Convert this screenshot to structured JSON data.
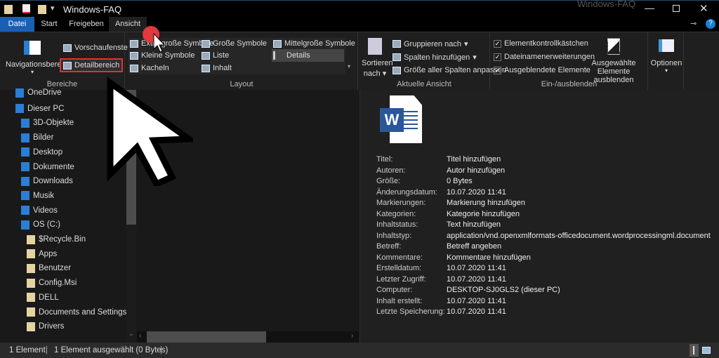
{
  "window": {
    "title": "Windows-FAQ",
    "watermark": "Windows-FAQ",
    "controls": [
      "minimize",
      "maximize",
      "close"
    ]
  },
  "tabs": [
    {
      "label": "Datei",
      "active_color": "#1a5fb4"
    },
    {
      "label": "Start"
    },
    {
      "label": "Freigeben"
    },
    {
      "label": "Ansicht",
      "selected": true
    }
  ],
  "ribbon": {
    "bereiche": {
      "label": "Bereiche",
      "navigationsbereich": "Navigationsbereich",
      "vorschaufenster": "Vorschaufenster",
      "detailbereich": "Detailbereich"
    },
    "layout": {
      "label": "Layout",
      "items": [
        "Extra große Symbole",
        "Große Symbole",
        "Mittelgroße Symbole",
        "Kleine Symbole",
        "Liste",
        "Details",
        "Kacheln",
        "Inhalt"
      ],
      "selected": "Details"
    },
    "aktuelle_ansicht": {
      "label": "Aktuelle Ansicht",
      "sortieren": "Sortieren",
      "nach": "nach",
      "gruppieren": "Gruppieren nach",
      "spalten": "Spalten hinzufügen",
      "groesse": "Größe aller Spalten anpassen"
    },
    "einaus": {
      "label": "Ein-/ausblenden",
      "checks": [
        {
          "label": "Elementkontrollkästchen",
          "checked": true
        },
        {
          "label": "Dateinamenerweiterungen",
          "checked": true
        },
        {
          "label": "Ausgeblendete Elemente",
          "checked": true
        }
      ],
      "hide1": "Ausgewählte",
      "hide2": "Elemente ausblenden"
    },
    "optionen": "Optionen"
  },
  "nav": [
    {
      "label": "OneDrive",
      "icon": "cloud-icon"
    },
    {
      "label": "Dieser PC",
      "icon": "computer-icon"
    },
    {
      "label": "3D-Objekte",
      "icon": "cube-icon"
    },
    {
      "label": "Bilder",
      "icon": "pictures-icon"
    },
    {
      "label": "Desktop",
      "icon": "desktop-icon"
    },
    {
      "label": "Dokumente",
      "icon": "document-icon"
    },
    {
      "label": "Downloads",
      "icon": "download-icon"
    },
    {
      "label": "Musik",
      "icon": "music-icon"
    },
    {
      "label": "Videos",
      "icon": "video-icon"
    },
    {
      "label": "OS (C:)",
      "icon": "drive-icon"
    },
    {
      "label": "$Recycle.Bin",
      "icon": "folder-icon"
    },
    {
      "label": "Apps",
      "icon": "folder-icon"
    },
    {
      "label": "Benutzer",
      "icon": "folder-icon"
    },
    {
      "label": "Config.Msi",
      "icon": "folder-icon"
    },
    {
      "label": "DELL",
      "icon": "folder-icon"
    },
    {
      "label": "Documents and Settings",
      "icon": "folder-icon"
    },
    {
      "label": "Drivers",
      "icon": "folder-icon"
    }
  ],
  "details": [
    [
      "Titel:",
      "Titel hinzufügen"
    ],
    [
      "Autoren:",
      "Autor hinzufügen"
    ],
    [
      "Größe:",
      "0 Bytes"
    ],
    [
      "Änderungsdatum:",
      "10.07.2020 11:41"
    ],
    [
      "Markierungen:",
      "Markierung hinzufügen"
    ],
    [
      "Kategorien:",
      "Kategorie hinzufügen"
    ],
    [
      "Inhaltstatus:",
      "Text hinzufügen"
    ],
    [
      "Inhaltstyp:",
      "application/vnd.openxmlformats-officedocument.wordprocessingml.document"
    ],
    [
      "Betreff:",
      "Betreff angeben"
    ],
    [
      "Kommentare:",
      "Kommentare hinzufügen"
    ],
    [
      "Erstelldatum:",
      "10.07.2020 11:41"
    ],
    [
      "Letzter Zugriff:",
      "10.07.2020 11:41"
    ],
    [
      "Computer:",
      "DESKTOP-SJ0GLS2 (dieser PC)"
    ],
    [
      "Inhalt erstellt:",
      "10.07.2020 11:41"
    ],
    [
      "Letzte Speicherung:",
      "10.07.2020 11:41"
    ]
  ],
  "file_icon": {
    "label": "W",
    "color": "#2b579a"
  },
  "status": {
    "count": "1 Element",
    "selected": "1 Element ausgewählt (0 Bytes)"
  }
}
